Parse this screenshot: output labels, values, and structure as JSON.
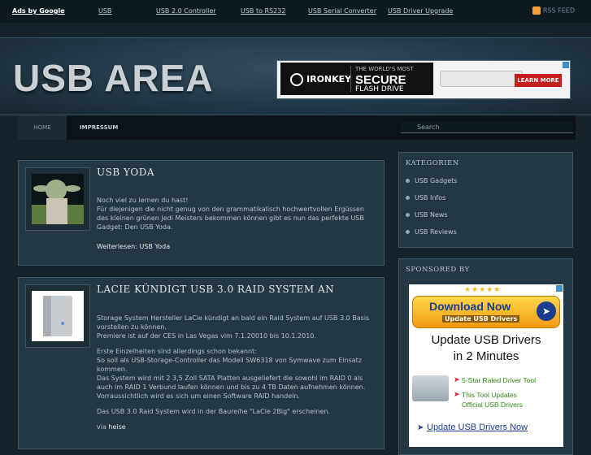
{
  "topbar": {
    "ads_label": "Ads by Google",
    "links": [
      "USB",
      "USB 2.0 Controller",
      "USB to RS232",
      "USB Serial Converter",
      "USB Driver Upgrade"
    ],
    "rss_label": "RSS FEED"
  },
  "header": {
    "logo": "USB AREA",
    "banner": {
      "brand": "IRONKEY",
      "line1": "THE WORLD'S MOST",
      "line2": "SECURE",
      "line3": "FLASH DRIVE",
      "cta": "LEARN MORE"
    }
  },
  "nav": {
    "items": [
      "HOME",
      "IMPRESSUM"
    ],
    "search_placeholder": "Search"
  },
  "posts": [
    {
      "title": "USB YODA",
      "paragraphs": [
        "Noch viel zu lernen du hast!",
        "Für diejenigen die nicht genug von den grammatikalisch hochwertvollen Ergüssen des kleinen grünen Jedi Meisters bekommen können gibt es nun das perfekte USB Gadget: Den USB Yoda."
      ],
      "read_more": "Weiterlesen: USB Yoda"
    },
    {
      "title": "LACIE KÜNDIGT USB 3.0 RAID SYSTEM AN",
      "paragraphs": [
        "Storage System Hersteller LaCie kündigt an bald ein Raid System auf USB 3.0 Basis vorstellen zu können.",
        "Premiere ist auf der CES in Las Vegas vim 7.1.20010 bis 10.1.2010.",
        "Erste Einzelheiten sind allerdings schon bekannt:",
        "So soll als USB-Storage-Controller das Modell SW6318 von Symwave zum Einsatz kommen.",
        "Das System wird mit 2 3,5 Zoll SATA Platten ausgeliefert die sowohl im RAID 0 als auch im RAID 1 Verbund laufen können und bis zu 4 TB Daten aufnehmen können.",
        "Vorraussichtlich wird es sich um einen Software RAID handeln.",
        "Das USB 3.0 Raid System wird in der Baureihe \"LaCie 2Big\" erscheinen."
      ],
      "via_prefix": "via",
      "via_link": "heise"
    }
  ],
  "sidebar": {
    "categories_title": "KATEGORIEN",
    "categories": [
      "USB Gadgets",
      "USB Infos",
      "USB News",
      "USB Reviews"
    ],
    "sponsored_title": "SPONSORED BY",
    "ad": {
      "stars": "★★★★★",
      "download": "Download Now",
      "download_sub": "Update USB Drivers",
      "headline1": "Update USB Drivers",
      "headline2": "in 2 Minutes",
      "feature1": "5-Star Rated Driver Tool",
      "feature2a": "This Tool Updates",
      "feature2b": "Official USB Drivers",
      "link": "Update USB Drivers Now"
    }
  }
}
